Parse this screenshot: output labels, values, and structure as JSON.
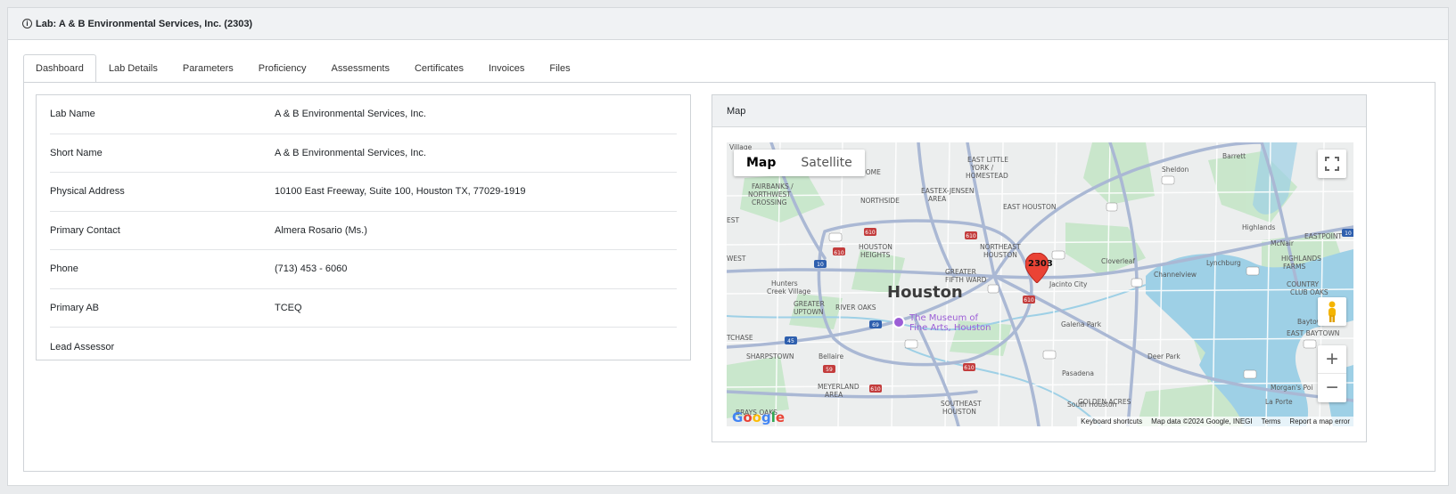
{
  "header": {
    "title": "Lab: A & B Environmental Services, Inc. (2303)"
  },
  "tabs": [
    "Dashboard",
    "Lab Details",
    "Parameters",
    "Proficiency",
    "Assessments",
    "Certificates",
    "Invoices",
    "Files"
  ],
  "details": [
    {
      "label": "Lab Name",
      "value": "A & B Environmental Services, Inc."
    },
    {
      "label": "Short Name",
      "value": "A & B Environmental Services, Inc."
    },
    {
      "label": "Physical Address",
      "value": "10100 East Freeway, Suite 100, Houston TX, 77029-1919"
    },
    {
      "label": "Primary Contact",
      "value": "Almera Rosario (Ms.)"
    },
    {
      "label": "Phone",
      "value": "(713) 453 - 6060"
    },
    {
      "label": "Primary AB",
      "value": "TCEQ"
    },
    {
      "label": "Lead Assessor",
      "value": ""
    }
  ],
  "map": {
    "title": "Map",
    "type_map": "Map",
    "type_satellite": "Satellite",
    "marker_label": "2303",
    "city_label": "Houston",
    "museum_label_1": "The Museum of",
    "museum_label_2": "Fine Arts, Houston",
    "places": [
      "Village",
      "FAIRBANKS /",
      "NORTHWEST",
      "CROSSING",
      "NORTHSIDE",
      "EASTEX-JENSEN",
      "AREA",
      "EAST LITTLE",
      "YORK /",
      "HOMESTEAD",
      "EAST HOUSTON",
      "Sheldon",
      "Barrett",
      "HOUSTON",
      "HEIGHTS",
      "NORTHEAST",
      "HOUSTON",
      "Highlands",
      "McNair",
      "EASTPOINT",
      "Hunters",
      "Creek Village",
      "GREATER",
      "FIFTH WARD",
      "Cloverleaf",
      "Jacinto City",
      "Channelview",
      "Lynchburg",
      "HIGHLANDS",
      "FARMS",
      "GREATER",
      "UPTOWN",
      "RIVER OAKS",
      "COUNTRY",
      "CLUB OAKS",
      "Galena Park",
      "Baytown",
      "SHARPSTOWN",
      "Bellaire",
      "EAST BAYTOWN",
      "Deer Park",
      "Pasadena",
      "MEYERLAND",
      "AREA",
      "Morgan's Poi",
      "SOUTHEAST",
      "HOUSTON",
      "GOLDEN ACRES",
      "South Houston",
      "La Porte",
      "BRAYS OAKS",
      "TCHASE",
      "EST",
      "WEST",
      "ERS HOME"
    ],
    "shields": [
      "290",
      "610",
      "610",
      "10",
      "610",
      "10",
      "45",
      "69",
      "288",
      "59",
      "610",
      "225",
      "610",
      "90",
      "8",
      "8",
      "330",
      "99",
      "225",
      "610",
      "90"
    ],
    "attribution": {
      "shortcuts": "Keyboard shortcuts",
      "data": "Map data ©2024 Google, INEGI",
      "terms": "Terms",
      "report": "Report a map error"
    },
    "logo": "Google"
  },
  "colors": {
    "water": "#9ed0e6",
    "highway": "#aab8d4",
    "park": "#c3e5c6",
    "marker": "#ea4335"
  }
}
